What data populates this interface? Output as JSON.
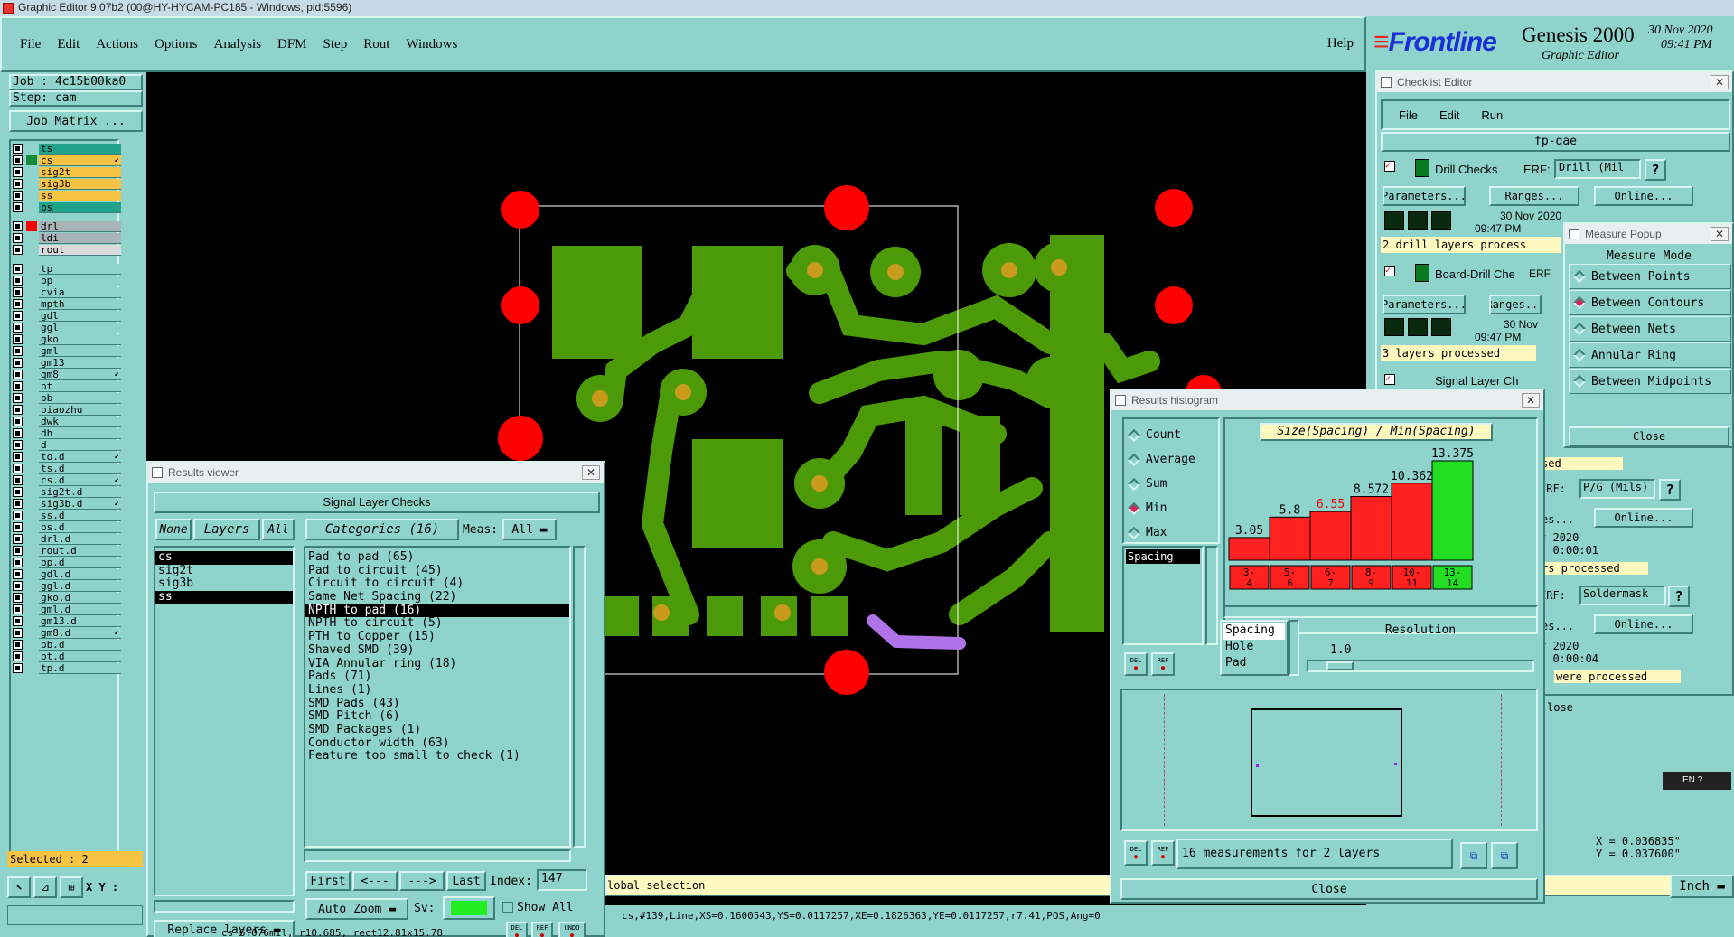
{
  "titlebar": {
    "text": "Graphic Editor 9.07b2 (00@HY-HYCAM-PC185 - Windows, pid:5596)"
  },
  "menu": [
    "File",
    "Edit",
    "Actions",
    "Options",
    "Analysis",
    "DFM",
    "Step",
    "Rout",
    "Windows"
  ],
  "help": "Help",
  "brand": {
    "logo": "Frontline",
    "product": "Genesis 2000",
    "subtitle": "Graphic Editor",
    "date": "30 Nov 2020",
    "time": "09:41 PM"
  },
  "job": {
    "job": "Job : 4c15b00ka0",
    "step": "Step: cam",
    "matrix": "Job Matrix ..."
  },
  "layers": {
    "group1": [
      {
        "name": "ts",
        "color": "#1fa38a"
      },
      {
        "name": "cs",
        "color": "#f7c342"
      },
      {
        "name": "sig2t",
        "color": "#f7c342"
      },
      {
        "name": "sig3b",
        "color": "#f7c342"
      },
      {
        "name": "ss",
        "color": "#f7c342"
      },
      {
        "name": "bs",
        "color": "#1fa38a"
      }
    ],
    "group2": [
      {
        "name": "drl",
        "color": "#a8b4b8"
      },
      {
        "name": "ldi",
        "color": "#a8b4b8"
      },
      {
        "name": "rout",
        "color": "#dcdcdc"
      }
    ],
    "group3": [
      "tp",
      "bp",
      "cvia",
      "mpth",
      "gdl",
      "ggl",
      "gko",
      "gml",
      "gm13",
      "gm8",
      "pt",
      "pb",
      "biaozhu",
      "dwk",
      "dh",
      "d",
      "to.d",
      "ts.d",
      "cs.d",
      "sig2t.d",
      "sig3b.d",
      "ss.d",
      "bs.d",
      "drl.d",
      "rout.d",
      "bp.d",
      "gdl.d",
      "ggl.d",
      "gko.d",
      "gml.d",
      "gm13.d",
      "gm8.d",
      "pb.d",
      "pt.d",
      "tp.d"
    ]
  },
  "selected": "Selected : 2",
  "xy_label": "X Y :",
  "status": {
    "global": "lobal selection",
    "feature": "cs,#139,Line,XS=0.1600543,YS=0.0117257,XE=0.1826363,YE=0.0117257,r7.41,POS,Ang=0",
    "bottom": "cs 6.076mil, r10.685, rect12.81x15.78"
  },
  "results_viewer": {
    "title": "Results viewer",
    "header": "Signal Layer Checks",
    "none": "None",
    "layers_label": "Layers",
    "all": "All",
    "layers": [
      "cs",
      "sig2t",
      "sig3b",
      "ss"
    ],
    "categories_label": "Categories (16)",
    "meas_label": "Meas:",
    "meas_value": "All",
    "categories": [
      "Pad to pad (65)",
      "Pad to circuit (45)",
      "Circuit to circuit (4)",
      "Same Net Spacing (22)",
      "NPTH to pad (16)",
      "NPTH to circuit (5)",
      "PTH to Copper (15)",
      "Shaved SMD (39)",
      "VIA Annular ring (18)",
      "Pads (71)",
      "Lines (1)",
      "SMD Pads (43)",
      "SMD Pitch (6)",
      "SMD Packages (1)",
      "Conductor width (63)",
      "Feature too small to check (1)"
    ],
    "first": "First",
    "prev": "<---",
    "next": "--->",
    "last": "Last",
    "index_label": "Index:",
    "index_value": "147",
    "auto_zoom": "Auto Zoom",
    "sv": "Sv:",
    "show_all": "Show All",
    "replace_layers": "Replace layers",
    "del": "DEL",
    "ref": "REF",
    "undo": "UNDO"
  },
  "checklist": {
    "title": "Checklist Editor",
    "menu": [
      "File",
      "Edit",
      "Run"
    ],
    "name": "fp-qae",
    "drill": {
      "label": "Drill Checks",
      "erf": "ERF:",
      "erf_value": "Drill (Mil",
      "date": "30 Nov 2020",
      "time": "09:47 PM",
      "processed": "2 drill layers process"
    },
    "parameters": "Parameters...",
    "ranges": "Ranges...",
    "online": "Online...",
    "board": {
      "label": "Board-Drill Che",
      "erf": "ERF",
      "date": "30 Nov",
      "time": "09:47 PM",
      "processed": "3 layers processed"
    },
    "signal": {
      "label": "Signal Layer Ch",
      "erf": "ERF"
    },
    "right_fragments": {
      "sed": "sed",
      "erf_pg": "P/G (Mils)",
      "es": "es...",
      "online": "Online...",
      "v2020": "v 2020",
      "dur1": "- 0:00:01",
      "rs_processed": "rs processed",
      "erf_sm": "Soldermask",
      "dur2": "- 0:00:04",
      "were": "were processed",
      "lose": "lose",
      "erf": "ERF:"
    }
  },
  "measure": {
    "title": "Measure Popup",
    "mode": "Measure Mode",
    "options": [
      "Between Points",
      "Between Contours",
      "Between Nets",
      "Annular Ring",
      "Between Midpoints"
    ],
    "selected": 1,
    "close": "Close"
  },
  "histogram": {
    "title": "Results histogram",
    "stats": [
      "Count",
      "Average",
      "Sum",
      "Min",
      "Max"
    ],
    "selected_stat": 3,
    "type": "Spacing",
    "chart_label": "Size(Spacing) / Min(Spacing)",
    "types": [
      "Spacing",
      "Hole",
      "Pad"
    ],
    "resolution_label": "Resolution",
    "resolution_value": "1.0",
    "summary": "16 measurements for 2 layers",
    "close": "Close",
    "del": "DEL",
    "ref": "REF"
  },
  "chart_data": {
    "type": "bar",
    "title": "Size(Spacing) / Min(Spacing)",
    "categories": [
      "3-4",
      "5-6",
      "6-7",
      "8-9",
      "10-11",
      "13-14"
    ],
    "values": [
      3.05,
      5.8,
      6.55,
      8.572,
      10.362,
      13.375
    ],
    "value_labels": [
      "3.05",
      "5.8",
      "6.55",
      "8.572",
      "10.362",
      "13.375"
    ],
    "tick_top": [
      "3-",
      "5-",
      "6-",
      "8-",
      "10-",
      "13-"
    ],
    "tick_bottom": [
      "4",
      "6",
      "7",
      "9",
      "11",
      "14"
    ],
    "colors": [
      "#ff2020",
      "#ff2020",
      "#ff2020",
      "#ff2020",
      "#ff2020",
      "#22dd22"
    ],
    "label_colors": [
      "#000",
      "#000",
      "#e00",
      "#000",
      "#000",
      "#000"
    ]
  },
  "coords": {
    "x": "X = 0.036835\"",
    "y": "Y = 0.037600\""
  },
  "units": "Inch",
  "tray": {
    "lang": "EN"
  },
  "colors": {
    "panel": "#8fd4cc",
    "canvas": "#000000",
    "copper": "#4d9a08",
    "pad": "#ff0000",
    "hole": "#c89b1c",
    "highlight": "#b072e8"
  }
}
